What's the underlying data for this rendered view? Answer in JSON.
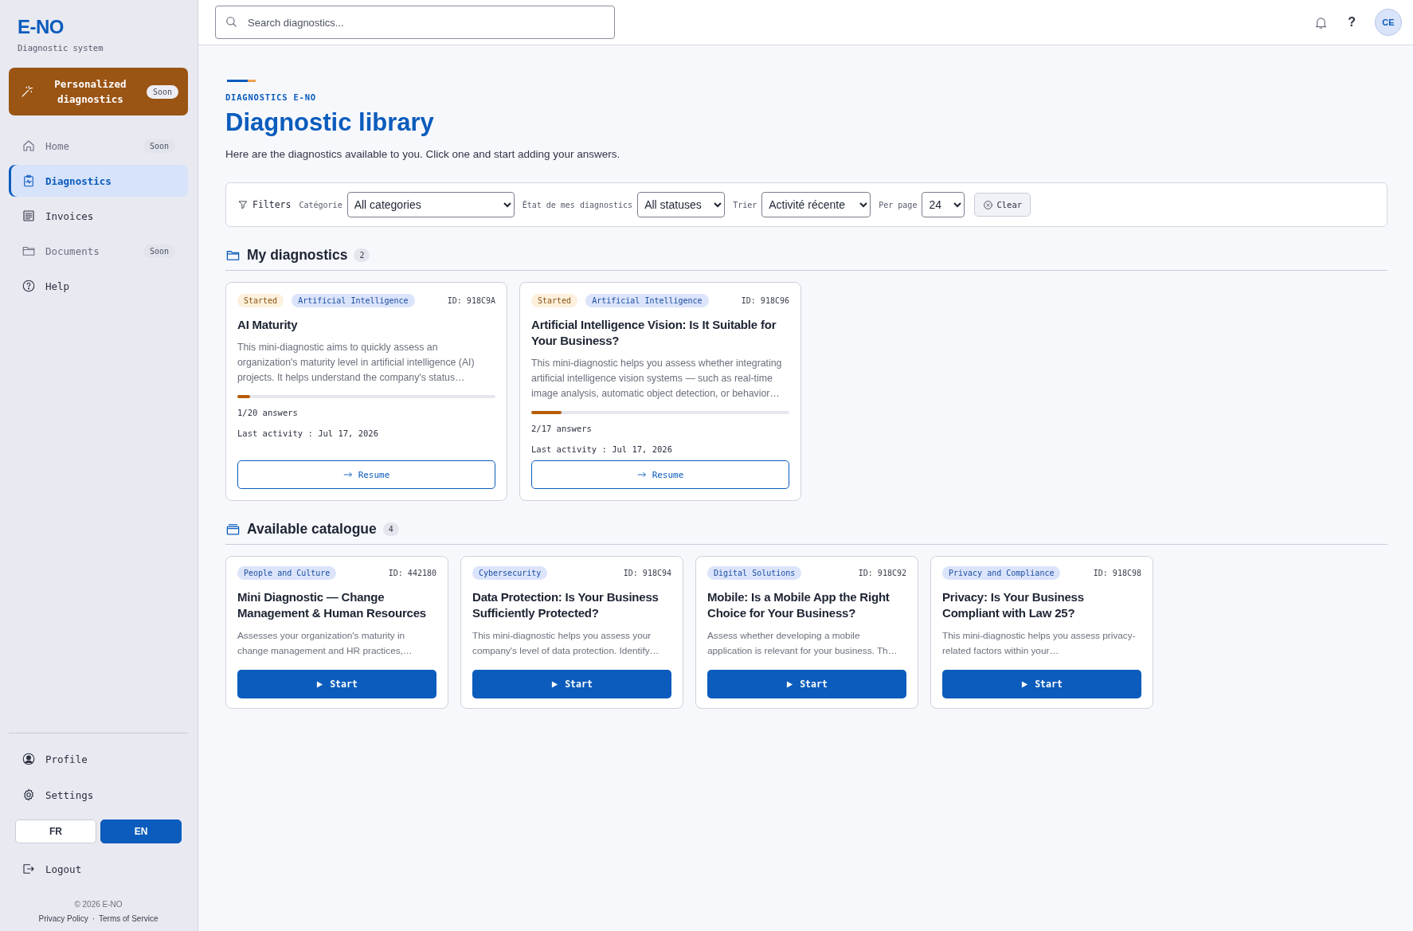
{
  "sidebar": {
    "logo": "E-NO",
    "tagline": "Diagnostic system",
    "promo": {
      "label": "Personalized diagnostics",
      "badge": "Soon"
    },
    "nav": [
      {
        "label": "Home",
        "badge": "Soon",
        "selected": false,
        "disabled": true
      },
      {
        "label": "Diagnostics",
        "selected": true,
        "disabled": false
      },
      {
        "label": "Invoices",
        "selected": false,
        "disabled": false
      },
      {
        "label": "Documents",
        "badge": "Soon",
        "selected": false,
        "disabled": true
      },
      {
        "label": "Help",
        "selected": false,
        "disabled": false
      }
    ],
    "bottom_nav": [
      {
        "label": "Profile"
      },
      {
        "label": "Settings"
      }
    ],
    "languages": [
      {
        "label": "FR",
        "selected": false
      },
      {
        "label": "EN",
        "selected": true
      }
    ],
    "logout": "Logout",
    "copyright": "© 2026 E-NO",
    "links": [
      "Privacy Policy",
      "Terms of Service"
    ],
    "separator": "·"
  },
  "header": {
    "search": {
      "placeholder": "Search diagnostics..."
    },
    "help": "?",
    "avatar": "CE"
  },
  "page": {
    "eyebrow": "DIAGNOSTICS E-NO",
    "title": "Diagnostic library",
    "subtitle": "Here are the diagnostics available to you. Click one and start adding your answers."
  },
  "filters": {
    "label": "Filters",
    "fields": [
      {
        "label": "Catégorie",
        "value": "All categories"
      },
      {
        "label": "État de mes diagnostics",
        "value": "All statuses"
      },
      {
        "label": "Trier",
        "value": "Activité récente"
      },
      {
        "label": "Per page",
        "value": "24"
      }
    ],
    "clear": "Clear"
  },
  "my_diagnostics": {
    "title": "My diagnostics",
    "count": "2",
    "cards": [
      {
        "status": "Started",
        "category": "Artificial Intelligence",
        "id": "ID: 918C9A",
        "title": "AI Maturity",
        "description": "This mini-diagnostic aims to quickly assess an organization's maturity level in artificial intelligence (AI) projects. It helps understand the company's status…",
        "level": 0.05,
        "answers": "1/20 answers",
        "last_activity": "Last activity : Jul 17, 2026",
        "action": "Resume"
      },
      {
        "status": "Started",
        "category": "Artificial Intelligence",
        "id": "ID: 918C96",
        "title": "Artificial Intelligence Vision: Is It Suitable for Your Business?",
        "description": "This mini-diagnostic helps you assess whether integrating artificial intelligence vision systems — such as real-time image analysis, automatic object detection, or behavior…",
        "level": 0.118,
        "answers": "2/17 answers",
        "last_activity": "Last activity : Jul 17, 2026",
        "action": "Resume"
      }
    ]
  },
  "catalogue": {
    "title": "Available catalogue",
    "count": "4",
    "cards": [
      {
        "category": "People and Culture",
        "id": "ID: 442180",
        "title": "Mini Diagnostic — Change Management & Human Resources",
        "description": "Assesses your organization's maturity in change management and HR practices,…",
        "action": "Start"
      },
      {
        "category": "Cybersecurity",
        "id": "ID: 918C94",
        "title": "Data Protection: Is Your Business Sufficiently Protected?",
        "description": "This mini-diagnostic helps you assess your company's level of data protection. Identify…",
        "action": "Start"
      },
      {
        "category": "Digital Solutions",
        "id": "ID: 918C92",
        "title": "Mobile: Is a Mobile App the Right Choice for Your Business?",
        "description": "Assess whether developing a mobile application is relevant for your business. Th…",
        "action": "Start"
      },
      {
        "category": "Privacy and Compliance",
        "id": "ID: 918C98",
        "title": "Privacy: Is Your Business Compliant with Law 25?",
        "description": "This mini-diagnostic helps you assess privacy-related factors within your…",
        "action": "Start"
      }
    ]
  }
}
